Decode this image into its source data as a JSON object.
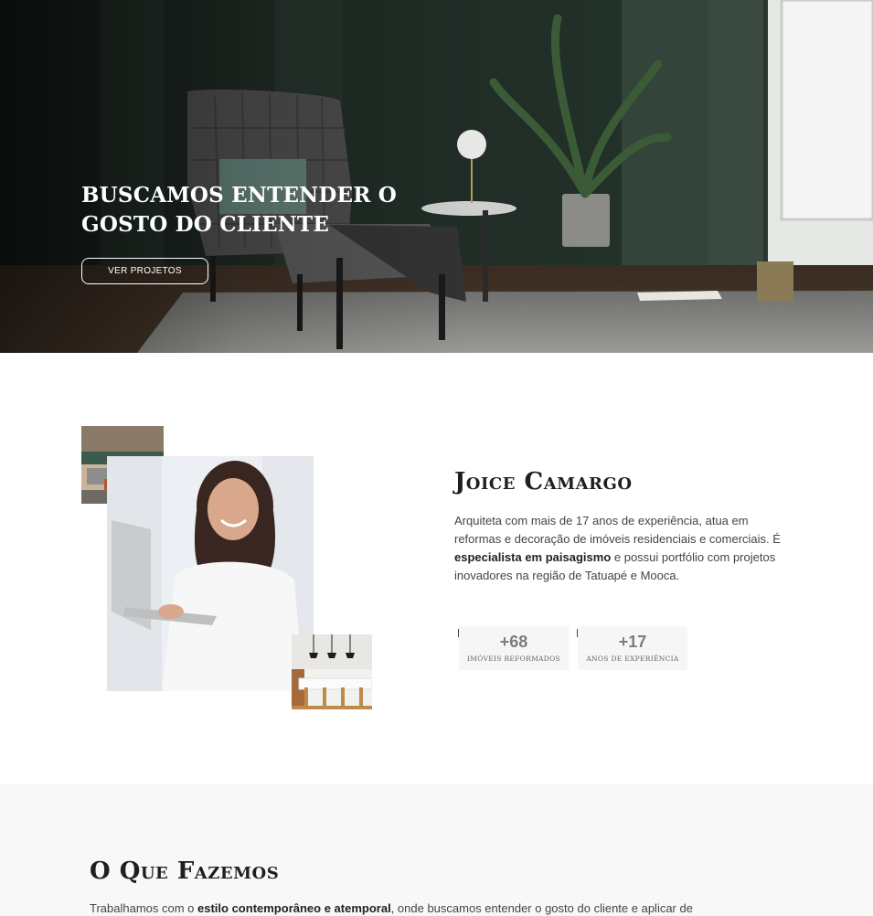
{
  "hero": {
    "title": "BUSCAMOS ENTENDER O GOSTO DO CLIENTE",
    "button_label": "VER PROJETOS"
  },
  "about": {
    "name": "Joice Camargo",
    "text_1": "Arquiteta com mais de 17 anos de experiência, atua em reformas e decoração de imóveis residenciais e comerciais. É ",
    "text_bold": "especialista em paisagismo",
    "text_2": " e possui portfólio com projetos inovadores na região de Tatuapé e Mooca.",
    "stats": [
      {
        "value": "+68",
        "label": "IMÓVEIS REFORMADOS"
      },
      {
        "value": "+17",
        "label": "ANOS DE EXPERIÊNCIA"
      }
    ]
  },
  "services": {
    "title": "O Que Fazemos",
    "text_1": "Trabalhamos com o ",
    "text_bold": "estilo contemporâneo e atemporal",
    "text_2": ", onde buscamos entender o gosto do cliente e aplicar de"
  },
  "colors": {
    "hero_wall": "#1e2a25",
    "accent_dark": "#1f1f1f",
    "stat_bg": "#f6f6f6",
    "section_bg": "#f8f8f8"
  }
}
